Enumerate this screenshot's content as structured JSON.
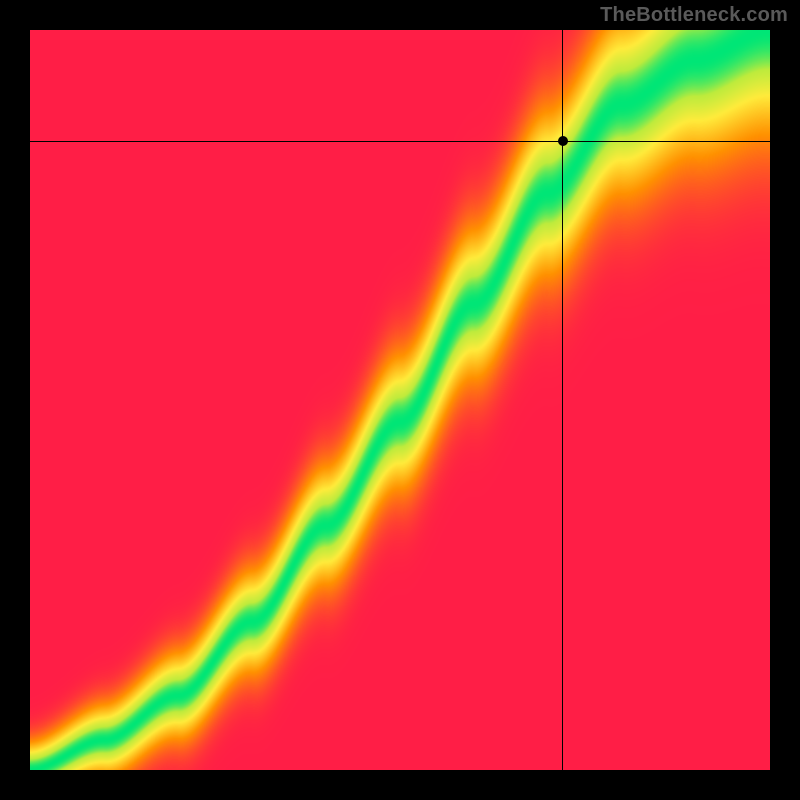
{
  "watermark": "TheBottleneck.com",
  "colors": {
    "background": "#000000",
    "watermark": "#5a5a5a",
    "gradient_low": "#ff1744",
    "gradient_mid_low": "#ff9100",
    "gradient_mid": "#ffeb3b",
    "gradient_high": "#00e676",
    "crosshair": "#000000",
    "marker": "#000000"
  },
  "chart_data": {
    "type": "heatmap",
    "title": "",
    "xlabel": "",
    "ylabel": "",
    "xlim": [
      0,
      1
    ],
    "ylim": [
      0,
      1
    ],
    "ideal_curve_description": "Green ridge indicating balanced match between x and y components; curve passes through origin and bends toward upper-right with slight S-shape.",
    "ideal_curve_control_points": [
      {
        "x": 0.0,
        "y": 0.0
      },
      {
        "x": 0.1,
        "y": 0.04
      },
      {
        "x": 0.2,
        "y": 0.1
      },
      {
        "x": 0.3,
        "y": 0.2
      },
      {
        "x": 0.4,
        "y": 0.33
      },
      {
        "x": 0.5,
        "y": 0.47
      },
      {
        "x": 0.6,
        "y": 0.63
      },
      {
        "x": 0.7,
        "y": 0.78
      },
      {
        "x": 0.8,
        "y": 0.9
      },
      {
        "x": 0.9,
        "y": 0.96
      },
      {
        "x": 1.0,
        "y": 1.0
      }
    ],
    "crosshair": {
      "x": 0.72,
      "y": 0.85
    },
    "marker": {
      "x": 0.72,
      "y": 0.85
    },
    "color_stops": [
      {
        "t": 0.0,
        "r": 255,
        "g": 30,
        "b": 70
      },
      {
        "t": 0.4,
        "r": 255,
        "g": 145,
        "b": 0
      },
      {
        "t": 0.7,
        "r": 255,
        "g": 235,
        "b": 59
      },
      {
        "t": 0.88,
        "r": 190,
        "g": 235,
        "b": 60
      },
      {
        "t": 1.0,
        "r": 0,
        "g": 230,
        "b": 118
      }
    ],
    "ridge_width": 0.055
  }
}
